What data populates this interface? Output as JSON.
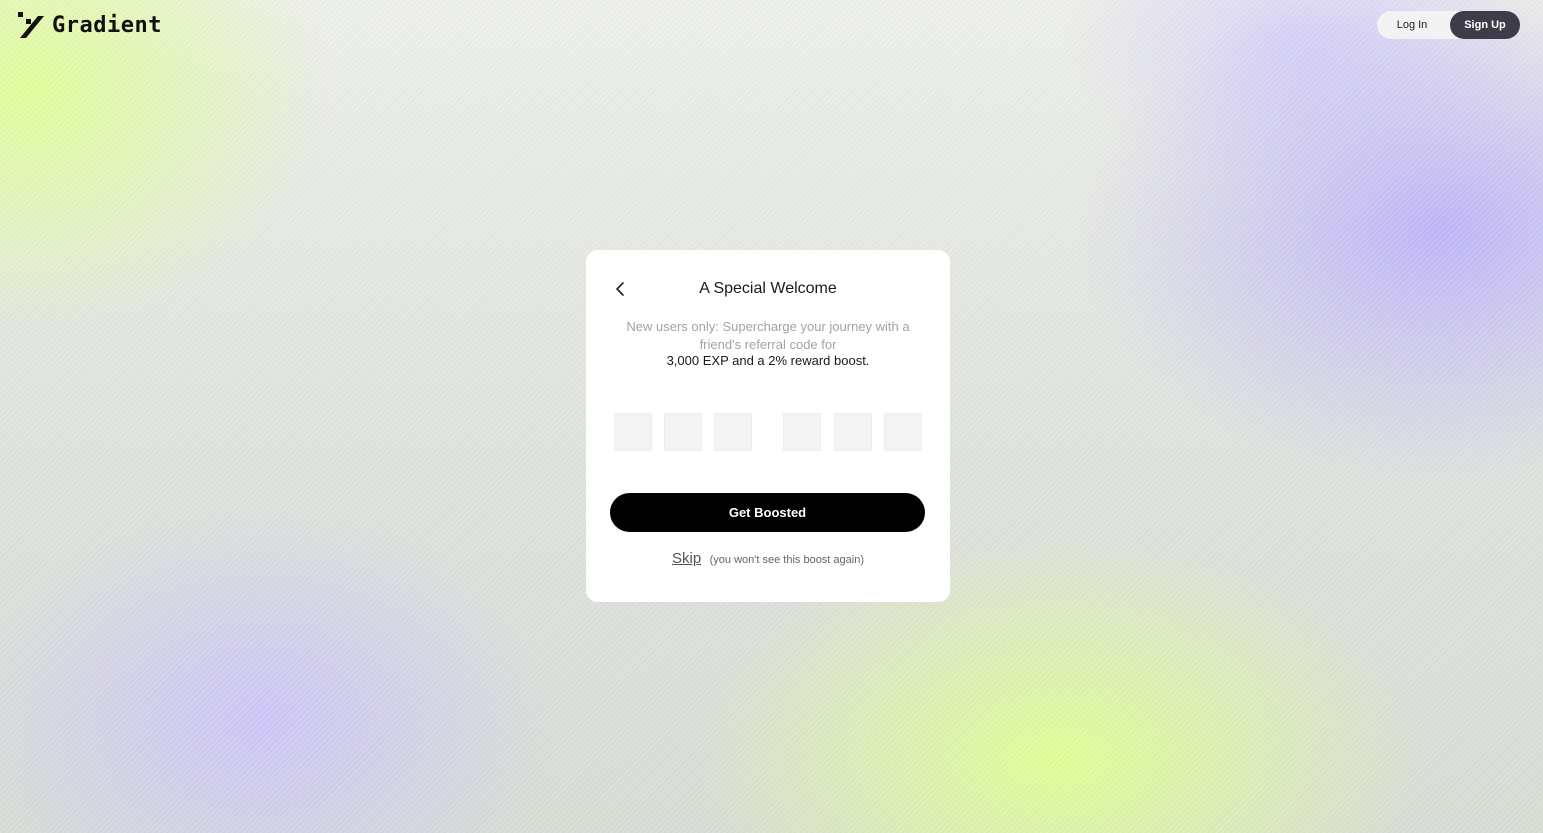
{
  "header": {
    "logo_text": "Gradient",
    "login_label": "Log In",
    "signup_label": "Sign Up"
  },
  "card": {
    "title": "A Special Welcome",
    "subtitle": "New users only: Supercharge your journey with a friend's referral code for",
    "highlight": "3,000 EXP and a 2% reward boost.",
    "code_inputs": [
      "",
      "",
      "",
      "",
      "",
      ""
    ],
    "submit_label": "Get Boosted",
    "skip_label": "Skip",
    "skip_note": "(you won't see this boost again)"
  },
  "colors": {
    "button_bg": "#000000",
    "signup_bg": "#3d3d49",
    "accent_green": "#e0ff96",
    "accent_purple": "#beb4fa"
  },
  "icons": {
    "logo": "gradient-logo-icon",
    "back": "chevron-left-icon"
  }
}
